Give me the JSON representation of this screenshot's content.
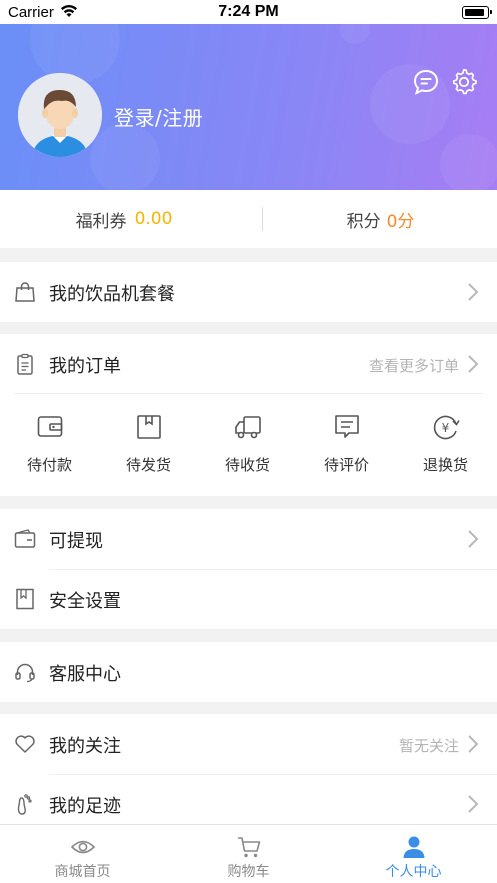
{
  "status_bar": {
    "carrier": "Carrier",
    "time": "7:24 PM"
  },
  "profile": {
    "login_label": "登录/注册"
  },
  "points": {
    "coupon_label": "福利券",
    "coupon_value": "0.00",
    "score_label": "积分",
    "score_value": "0分"
  },
  "menu": {
    "package": "我的饮品机套餐",
    "orders": {
      "label": "我的订单",
      "more": "查看更多订单"
    },
    "order_states": [
      "待付款",
      "待发货",
      "待收货",
      "待评价",
      "退换货"
    ],
    "withdraw": "可提现",
    "security": "安全设置",
    "service": "客服中心",
    "follow": {
      "label": "我的关注",
      "right": "暂无关注"
    },
    "footprint": "我的足迹"
  },
  "tabbar": {
    "items": [
      "商城首页",
      "购物车",
      "个人中心"
    ],
    "active_index": 2
  },
  "colors": {
    "accent": "#3b8de8",
    "coupon": "#f7b500",
    "score": "#f38b2d",
    "gradient_start": "#6a8ff7",
    "gradient_end": "#a77df3"
  }
}
